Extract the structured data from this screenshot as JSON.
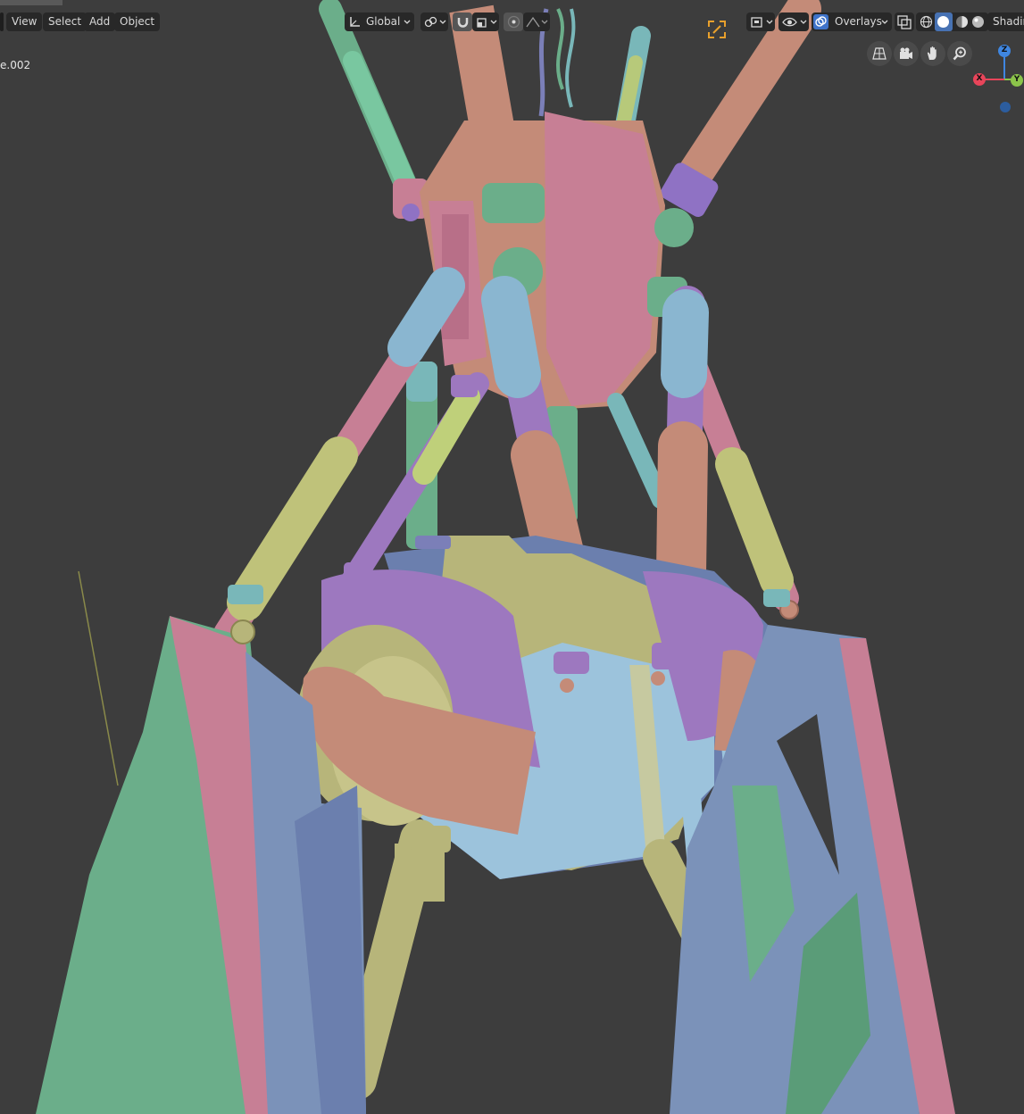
{
  "menu": {
    "view_label": "View",
    "select_label": "Select",
    "add_label": "Add",
    "object_label": "Object"
  },
  "object_name": "e.002",
  "toolbar": {
    "orientation_label": "Global",
    "overlays_label": "Overlays",
    "shading_label": "Shadin"
  },
  "gizmo": {
    "x_label": "X",
    "y_label": "Y",
    "z_label": "Z"
  },
  "icons": {
    "transform_orientation": "axes-icon",
    "pivot": "pivot-icon",
    "snap": "magnet-icon",
    "snap_target": "snap-target-icon",
    "proportional": "proportional-edit-icon",
    "falloff": "falloff-icon",
    "camera_frame": "camera-frame-icon",
    "view_object_types": "object-types-icon",
    "gizmo_toggle": "gizmo-toggle-icon",
    "overlay_toggle": "overlay-icon",
    "xray": "xray-icon",
    "wireframe": "wireframe-shading-icon",
    "solid": "solid-shading-icon",
    "material": "material-shading-icon",
    "rendered": "rendered-shading-icon",
    "perspective": "perspective-grid-icon",
    "camera": "camera-icon",
    "pan": "hand-pan-icon",
    "zoom": "zoom-icon"
  },
  "colors": {
    "background": "#3d3d3d",
    "header_button": "#282828",
    "pink": "#c77f95",
    "salmon": "#c48b78",
    "green": "#6bae8a",
    "blue_grey": "#7b92b9",
    "light_blue": "#9cc3dc",
    "purple": "#9d78bf",
    "olive": "#b7b57a",
    "cyan": "#79b7b9",
    "axis_x": "#e8455a",
    "axis_y": "#8bc34a",
    "axis_z": "#3f86e0",
    "snap_orange": "#e8a02c"
  }
}
